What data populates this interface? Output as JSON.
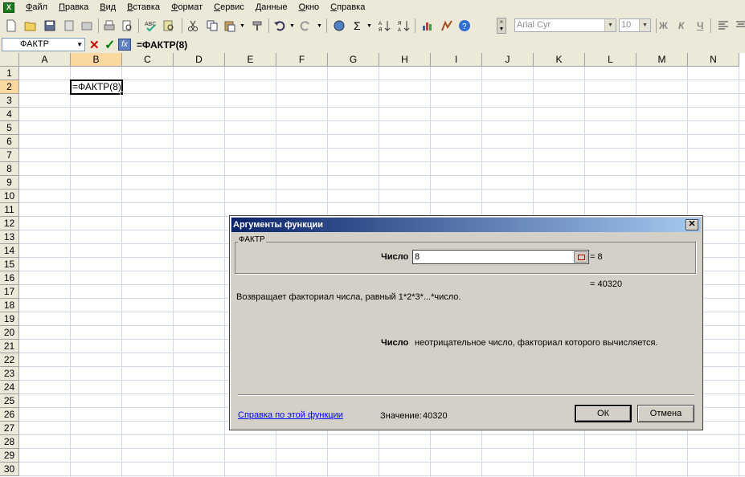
{
  "menu": {
    "icon": "excel-icon",
    "items": [
      "Файл",
      "Правка",
      "Вид",
      "Вставка",
      "Формат",
      "Сервис",
      "Данные",
      "Окно",
      "Справка"
    ]
  },
  "toolbar": {
    "font_name": "Arial Cyr",
    "font_size": "10",
    "bold": "Ж",
    "italic": "К",
    "underline": "Ч",
    "sigma": "Σ"
  },
  "formula_bar": {
    "name_box": "ФАКТР",
    "cancel": "✕",
    "enter": "✓",
    "fx": "fx",
    "formula": "=ФАКТР(8)"
  },
  "sheet": {
    "columns": [
      "A",
      "B",
      "C",
      "D",
      "E",
      "F",
      "G",
      "H",
      "I",
      "J",
      "K",
      "L",
      "M",
      "N"
    ],
    "rows": [
      "1",
      "2",
      "3",
      "4",
      "5",
      "6",
      "7",
      "8",
      "9",
      "10",
      "11",
      "12",
      "13",
      "14",
      "15",
      "16",
      "17",
      "18",
      "19",
      "20",
      "21",
      "22",
      "23",
      "24",
      "25",
      "26",
      "27",
      "28",
      "29",
      "30"
    ],
    "active_cell_text": "=ФАКТР(8)",
    "selected_column": "B",
    "selected_row": "2"
  },
  "dialog": {
    "title": "Аргументы функции",
    "close": "✕",
    "group_label": "ФАКТР",
    "arg_label": "Число",
    "arg_value": "8",
    "arg_result": "= 8",
    "total_result": "= 40320",
    "description": "Возвращает факториал числа, равный 1*2*3*...*число.",
    "arg_help_name": "Число",
    "arg_help_text": "неотрицательное число, факториал которого вычисляется.",
    "help_link": "Справка по этой функции",
    "value_label": "Значение:",
    "value": "40320",
    "ok": "ОК",
    "cancel": "Отмена"
  }
}
